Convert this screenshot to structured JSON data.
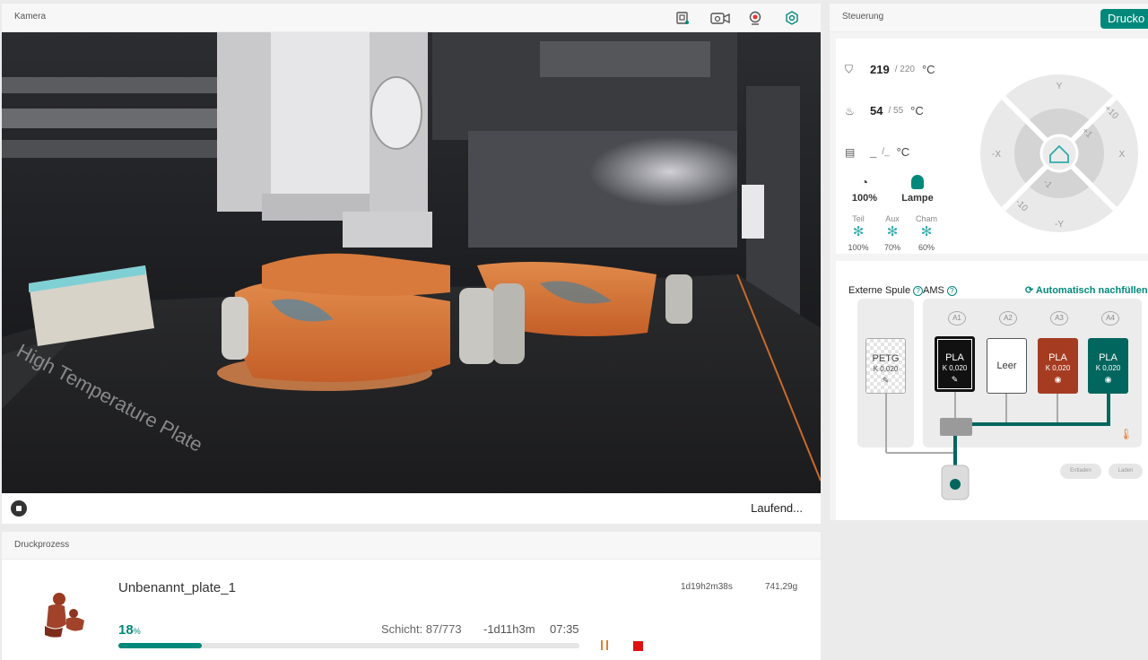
{
  "camera": {
    "title": "Kamera",
    "status": "Laufend..."
  },
  "process": {
    "title": "Druckprozess",
    "job_name": "Unbenannt_plate_1",
    "total_time": "1d19h2m38s",
    "weight": "741,29g",
    "progress_percent": 18,
    "progress_unit": "%",
    "layer": "Schicht: 87/773",
    "remaining": "-1d11h3m",
    "eta": "07:35"
  },
  "control": {
    "title": "Steuerung",
    "print_button": "Drucko",
    "nozzle": {
      "current": "219",
      "target": "/ 220",
      "unit": "°C"
    },
    "bed": {
      "current": "54",
      "target": "/ 55",
      "unit": "°C"
    },
    "chamber": {
      "current": "_",
      "target": "/_",
      "unit": "°C"
    },
    "speed": "100%",
    "lamp": "Lampe",
    "fans": [
      {
        "label": "Teil",
        "value": "100%"
      },
      {
        "label": "Aux",
        "value": "70%"
      },
      {
        "label": "Cham",
        "value": "60%"
      }
    ],
    "jog": {
      "y": "Y",
      "minus_y": "-Y",
      "x": "X",
      "minus_x": "-X",
      "plus10": "+10",
      "plus1": "+1",
      "minus1": "-1",
      "minus10": "-10"
    }
  },
  "ams": {
    "external_label": "Externe Spule",
    "ams_label": "AMS",
    "auto_refill": "Automatisch nachfüllen",
    "external_spool": {
      "type": "PETG",
      "k": "K 0,020"
    },
    "slots": [
      {
        "tag": "A1",
        "type": "PLA",
        "k": "K 0,020",
        "color": "#111111"
      },
      {
        "tag": "A2",
        "type": "Leer",
        "k": "",
        "color": "#ffffff"
      },
      {
        "tag": "A3",
        "type": "PLA",
        "k": "K 0,020",
        "color": "#a53c22"
      },
      {
        "tag": "A4",
        "type": "PLA",
        "k": "K 0,020",
        "color": "#00665e"
      }
    ],
    "unload": "Entladen",
    "load": "Laden"
  }
}
